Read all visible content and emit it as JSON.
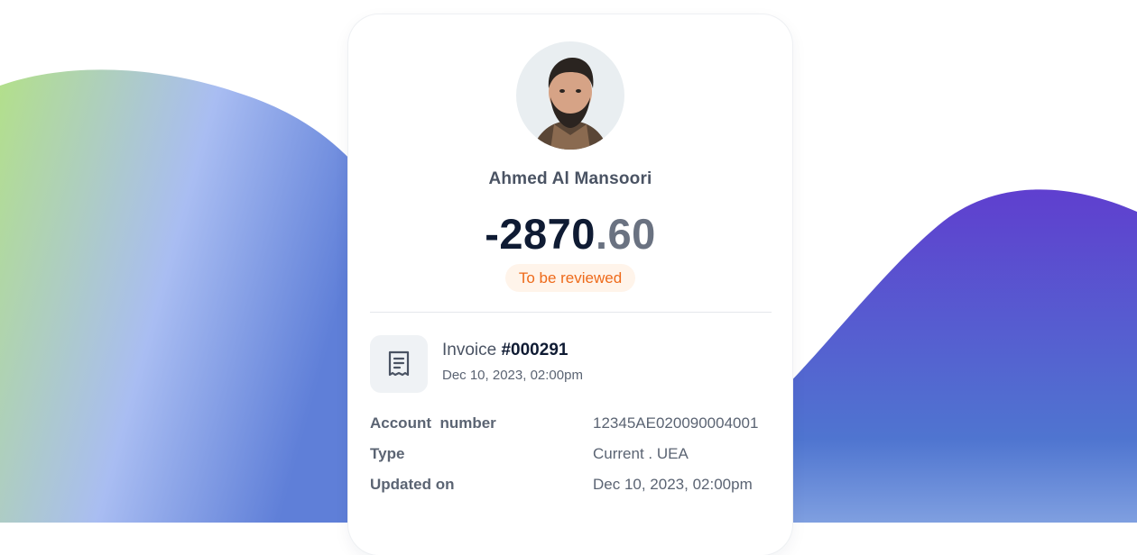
{
  "profile": {
    "name": "Ahmed Al Mansoori"
  },
  "transaction": {
    "sign": "-",
    "amount_whole": "2870",
    "amount_decimal": ".60",
    "status": "To be reviewed"
  },
  "invoice": {
    "label": "Invoice",
    "number": "#000291",
    "date": "Dec 10, 2023, 02:00pm",
    "icon": "receipt-icon"
  },
  "details": [
    {
      "key": "Account  number",
      "value": "12345AE020090004001"
    },
    {
      "key": "Type",
      "value": "Current . UEA"
    },
    {
      "key": "Updated on",
      "value": "Dec 10, 2023, 02:00pm"
    }
  ],
  "colors": {
    "amount": "#0f1b33",
    "status_text": "#ee6a1a",
    "status_bg": "#fff4ea",
    "wave_left_start": "#b3e08a",
    "wave_left_mid": "#a9bdf2",
    "wave_right_top": "#5f3fcf",
    "wave_right_bottom": "#4f7fd6"
  }
}
